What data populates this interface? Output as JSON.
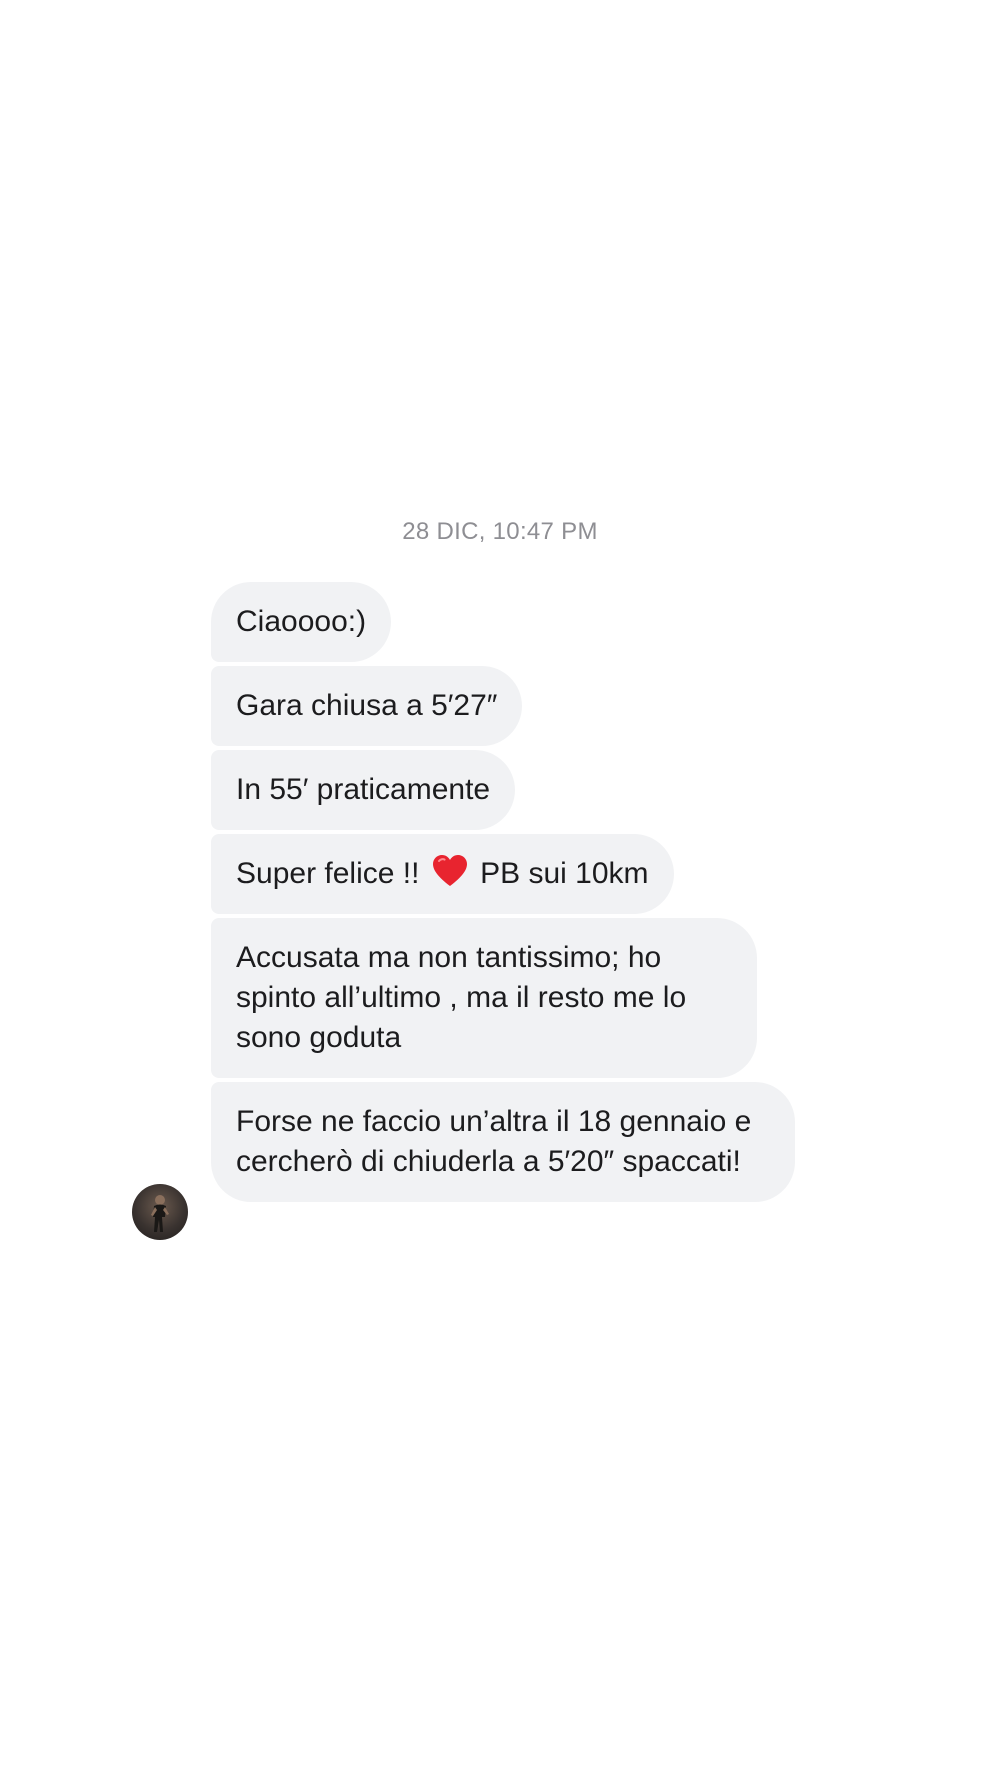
{
  "conversation": {
    "timestamp": "28 DIC, 10:47 PM",
    "messages": [
      {
        "text": "Ciaoooo:)"
      },
      {
        "text": "Gara chiusa a 5′27″"
      },
      {
        "text": "In 55′ praticamente"
      },
      {
        "text_before": "Super felice !! ",
        "emoji": "red-heart",
        "text_after": " PB sui 10km"
      },
      {
        "text": "Accusata ma non tantissimo; ho spinto all’ultimo , ma il resto me lo sono goduta"
      },
      {
        "text": "Forse ne faccio un’altra il 18 gennaio e cercherò di chiuderla a 5′20″ spaccati!"
      }
    ],
    "sender_avatar": "avatar-photo-runner"
  },
  "colors": {
    "bubble_background": "#f1f2f4",
    "text": "#1c1c1e",
    "timestamp_text": "#8e8e93",
    "heart": "#e8242f"
  }
}
